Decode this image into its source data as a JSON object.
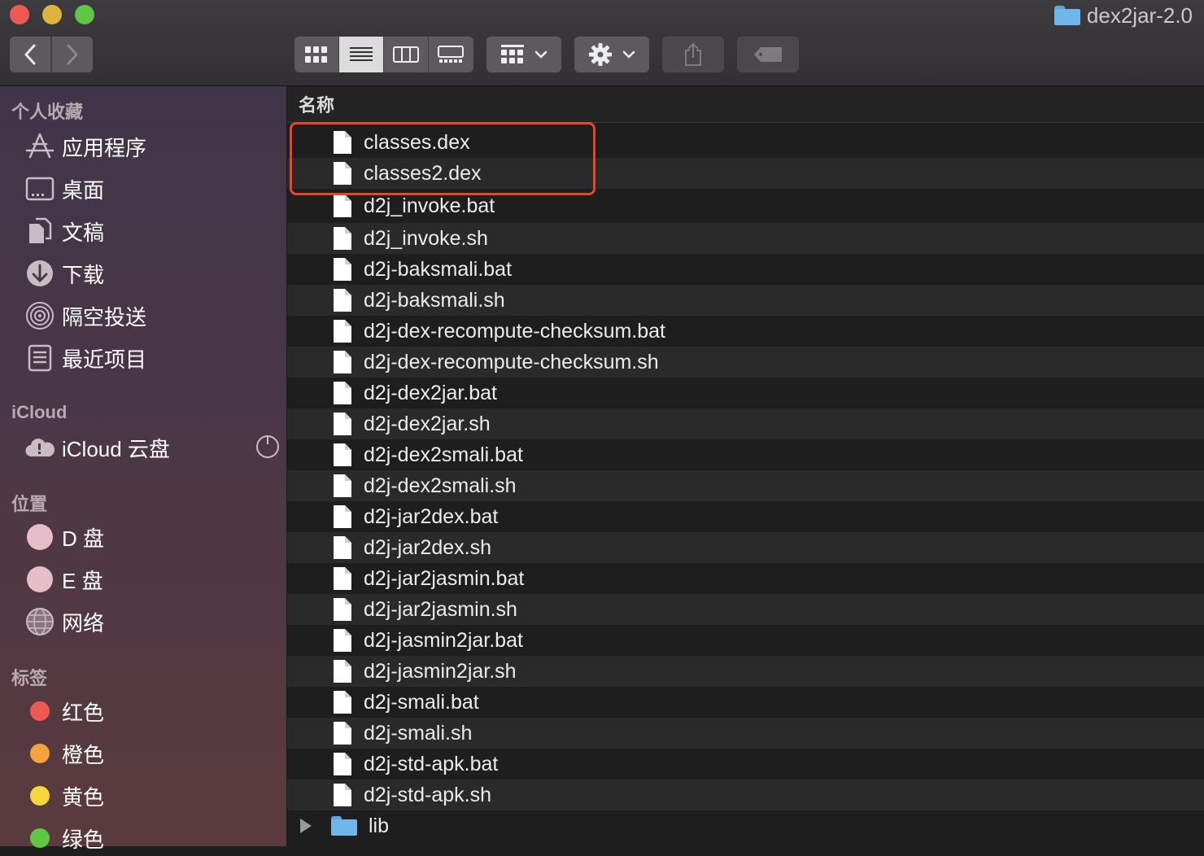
{
  "window": {
    "title": "dex2jar-2.0"
  },
  "sidebar": {
    "sections": [
      {
        "heading": "个人收藏"
      },
      {
        "heading": "iCloud"
      },
      {
        "heading": "位置"
      },
      {
        "heading": "标签"
      }
    ],
    "favorites": [
      {
        "label": "应用程序",
        "icon": "applications-icon"
      },
      {
        "label": "桌面",
        "icon": "desktop-icon"
      },
      {
        "label": "文稿",
        "icon": "documents-icon"
      },
      {
        "label": "下载",
        "icon": "downloads-icon"
      },
      {
        "label": "隔空投送",
        "icon": "airdrop-icon"
      },
      {
        "label": "最近项目",
        "icon": "recents-icon"
      }
    ],
    "icloud": [
      {
        "label": "iCloud 云盘",
        "icon": "cloud-icon"
      }
    ],
    "locations": [
      {
        "label": "D 盘",
        "icon": "disk-icon"
      },
      {
        "label": "E 盘",
        "icon": "disk-icon"
      },
      {
        "label": "网络",
        "icon": "network-globe-icon"
      }
    ],
    "tags": [
      {
        "label": "红色",
        "color": "#ee5a52"
      },
      {
        "label": "橙色",
        "color": "#f2a33a"
      },
      {
        "label": "黄色",
        "color": "#f2d83a"
      },
      {
        "label": "绿色",
        "color": "#5ec744"
      }
    ]
  },
  "list": {
    "column_header": "名称",
    "files": [
      "classes.dex",
      "classes2.dex",
      "d2j_invoke.bat",
      "d2j_invoke.sh",
      "d2j-baksmali.bat",
      "d2j-baksmali.sh",
      "d2j-dex-recompute-checksum.bat",
      "d2j-dex-recompute-checksum.sh",
      "d2j-dex2jar.bat",
      "d2j-dex2jar.sh",
      "d2j-dex2smali.bat",
      "d2j-dex2smali.sh",
      "d2j-jar2dex.bat",
      "d2j-jar2dex.sh",
      "d2j-jar2jasmin.bat",
      "d2j-jar2jasmin.sh",
      "d2j-jasmin2jar.bat",
      "d2j-jasmin2jar.sh",
      "d2j-smali.bat",
      "d2j-smali.sh",
      "d2j-std-apk.bat",
      "d2j-std-apk.sh"
    ],
    "folders": [
      "lib"
    ],
    "highlighted": [
      "classes.dex",
      "classes2.dex"
    ]
  }
}
